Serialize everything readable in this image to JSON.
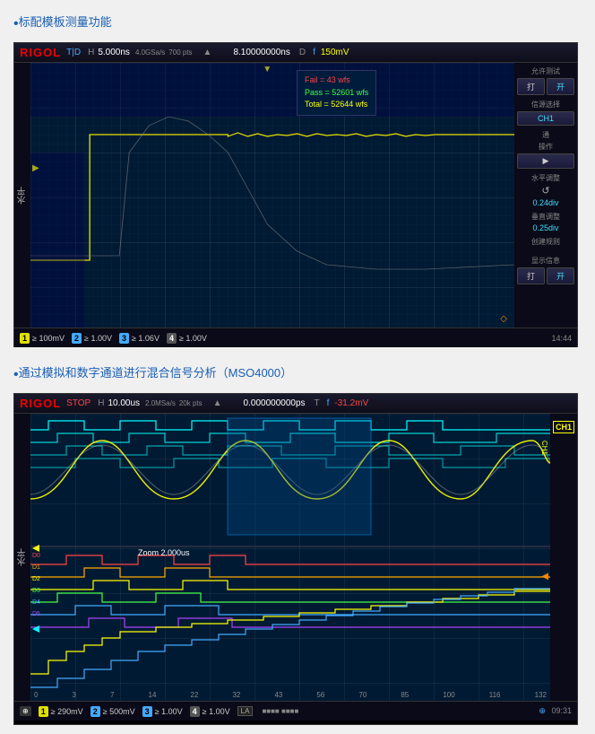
{
  "section1": {
    "link_text": "标配模板测量功能",
    "header": {
      "logo": "RIGOL",
      "mode": "T|D",
      "time_div": "H  5.000ns",
      "sample_rate": "4.0GSa/s",
      "extra": "700 pts",
      "trigger_pos": "8.10000000ns",
      "coupling": "D",
      "voltage": "f  150mV"
    },
    "mask_info": {
      "fail": "Fail = 43 wfs",
      "pass": "Pass = 52601 wfs",
      "total": "Total = 52644 wfs"
    },
    "sidebar": {
      "label1": "允许测试",
      "btn1a": "打",
      "btn1b": "开",
      "label2": "信源选择",
      "ch": "CH1",
      "label3": "通",
      "label4": "操作",
      "arrow": "▶",
      "label5": "水平调整",
      "rotate": "↺",
      "val1": "0.24div",
      "label6": "垂直调整",
      "val2": "0.25div",
      "label7": "创建规则",
      "label8": "显示信息",
      "btn2a": "打",
      "btn2b": "开"
    },
    "footer": {
      "ch1_num": "1",
      "ch1_val": "≥  100mV",
      "ch2_num": "2",
      "ch2_val": "≥  1.00V",
      "ch3_num": "3",
      "ch3_val": "≥  1.06V",
      "ch4_num": "4",
      "ch4_val": "≥  1.00V",
      "time": "14:44"
    }
  },
  "section2": {
    "link_text": "通过模拟和数字通道进行混合信号分析（MSO4000）",
    "header": {
      "logo": "RIGOL",
      "mode": "STOP",
      "time_div": "H  10.00us",
      "sample_rate": "2.0MSa/s",
      "extra": "20k pts",
      "trigger_pos": "0.000000000ps",
      "coupling": "T",
      "voltage": "f  -31.2mV"
    },
    "zoom_label": "Zoom 2.000us",
    "ch1_badge": "CH1",
    "sidebar": {
      "ch1_label": "CH1"
    },
    "footer": {
      "ch1_num": "1",
      "ch1_val": "≥  290mV",
      "ch2_num": "2",
      "ch2_val": "≥  500mV",
      "ch3_num": "3",
      "ch3_val": "≥  1.00V",
      "ch4_num": "4",
      "ch4_val": "≥  1.00V",
      "la_label": "LA",
      "usb": "⊕",
      "time": "09:31"
    },
    "xaxis": {
      "labels": [
        "0",
        "3",
        "7",
        "14",
        "22",
        "32",
        "43",
        "56",
        "70",
        "85",
        "100",
        "116",
        "132"
      ]
    }
  }
}
